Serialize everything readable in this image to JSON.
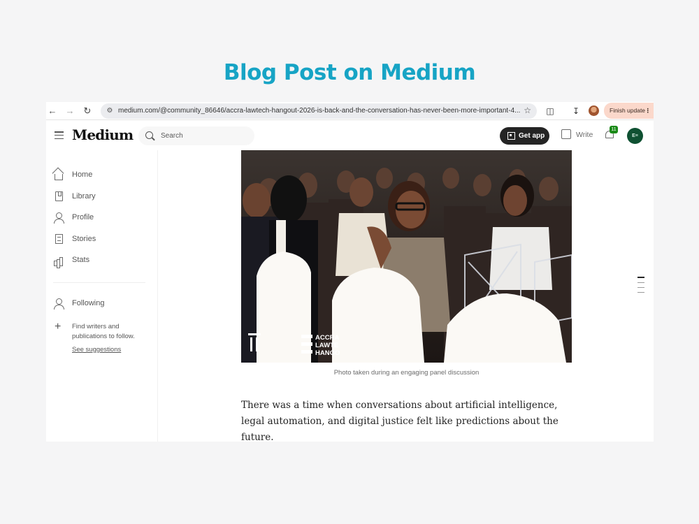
{
  "headline": "Blog Post on Medium",
  "browser": {
    "url": "medium.com/@community_86646/accra-lawtech-hangout-2026-is-back-and-the-conversation-has-never-been-more-important-4...",
    "finish_update": "Finish update",
    "menu_dots": "⋮"
  },
  "medium": {
    "logo": "Medium",
    "search_placeholder": "Search",
    "get_app": "Get app",
    "write": "Write",
    "notifications_count": "11",
    "avatar_initials": "E≡"
  },
  "sidebar": {
    "items": [
      {
        "label": "Home"
      },
      {
        "label": "Library"
      },
      {
        "label": "Profile"
      },
      {
        "label": "Stories"
      },
      {
        "label": "Stats"
      }
    ],
    "following": "Following",
    "find_text": "Find writers and publications to follow.",
    "see_suggestions": "See suggestions"
  },
  "article": {
    "photo_logo_text": [
      "ACCRA",
      "LAWTE",
      "HANGO"
    ],
    "caption": "Photo taken during an engaging panel discussion",
    "paragraph": "There was a time when conversations about artificial intelligence, legal automation, and digital justice felt like predictions about the future."
  },
  "colors": {
    "headline": "#17a4c5",
    "get_app_bg": "#242424",
    "badge": "#1a8917",
    "finish_update_bg": "#fbd8cb"
  }
}
